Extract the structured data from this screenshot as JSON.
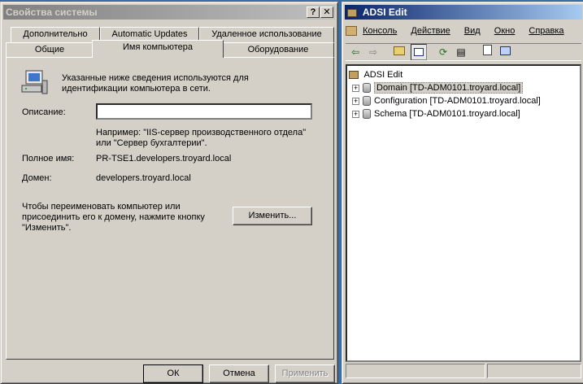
{
  "sysprops": {
    "title": "Свойства системы",
    "help_btn": "?",
    "close_btn": "✕",
    "tabs_top": [
      "Дополнительно",
      "Automatic Updates",
      "Удаленное использование"
    ],
    "tabs_bottom": [
      "Общие",
      "Имя компьютера",
      "Оборудование"
    ],
    "info_text_1": "Указанные ниже сведения используются для",
    "info_text_2": "идентификации компьютера в сети.",
    "desc_label": "Описание:",
    "desc_value": "",
    "example_1": "Например: \"IIS-сервер производственного отдела\"",
    "example_2": "или \"Сервер бухгалтерии\".",
    "fullname_label": "Полное имя:",
    "fullname_value": "PR-TSE1.developers.troyard.local",
    "domain_label": "Домен:",
    "domain_value": "developers.troyard.local",
    "rename_text_1": "Чтобы переименовать компьютер или",
    "rename_text_2": "присоединить его к домену, нажмите кнопку",
    "rename_text_3": "\"Изменить\".",
    "change_button": "Изменить...",
    "ok_button": "ОК",
    "cancel_button": "Отмена",
    "apply_button": "Применить"
  },
  "adsi": {
    "title": "ADSI Edit",
    "menu": [
      "Консоль",
      "Действие",
      "Вид",
      "Окно",
      "Справка"
    ],
    "root": "ADSI Edit",
    "nodes": [
      "Domain [TD-ADM0101.troyard.local]",
      "Configuration [TD-ADM0101.troyard.local]",
      "Schema [TD-ADM0101.troyard.local]"
    ]
  }
}
